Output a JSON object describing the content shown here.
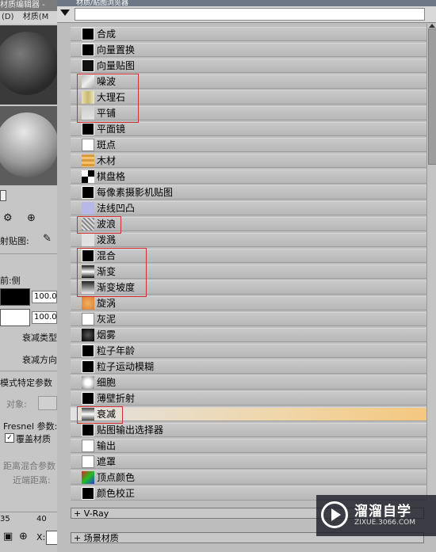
{
  "left_panel": {
    "title": "材质编辑器 -",
    "menu": [
      "(D)",
      "材质(M"
    ],
    "map_label": "射贴图:",
    "falloff_header": "前:侧",
    "val1": "100.0",
    "val2": "100.0",
    "falloff_type": "衰减类型",
    "falloff_dir": "衰减方向",
    "mode_params": "模式特定参数",
    "object_label": "对象:",
    "fresnel_label": "Fresnel 参数:",
    "override_label": "覆盖材质",
    "distance_blend": "距离混合参数",
    "near_distance": "近端距离:",
    "ruler": [
      "35",
      "40"
    ],
    "x_label": "X:"
  },
  "browser": {
    "title": "材质/贴图浏览器",
    "items": [
      {
        "label": "合成",
        "icon": "black-swatch-icon"
      },
      {
        "label": "向量置换",
        "icon": "black-swatch-icon"
      },
      {
        "label": "向量贴图",
        "icon": "vector-map-icon"
      },
      {
        "label": "噪波",
        "icon": "noise-icon"
      },
      {
        "label": "大理石",
        "icon": "marble-icon"
      },
      {
        "label": "平铺",
        "icon": "tiles-icon"
      },
      {
        "label": "平面镜",
        "icon": "black-swatch-icon"
      },
      {
        "label": "斑点",
        "icon": "white-swatch-icon"
      },
      {
        "label": "木材",
        "icon": "wood-icon"
      },
      {
        "label": "棋盘格",
        "icon": "checker-icon"
      },
      {
        "label": "每像素摄影机贴图",
        "icon": "black-swatch-icon"
      },
      {
        "label": "法线凹凸",
        "icon": "normal-bump-icon"
      },
      {
        "label": "波浪",
        "icon": "waves-icon"
      },
      {
        "label": "泼溅",
        "icon": "splat-icon"
      },
      {
        "label": "混合",
        "icon": "black-swatch-icon"
      },
      {
        "label": "渐变",
        "icon": "gradient-icon"
      },
      {
        "label": "渐变坡度",
        "icon": "gradient-ramp-icon"
      },
      {
        "label": "旋涡",
        "icon": "swirl-icon"
      },
      {
        "label": "灰泥",
        "icon": "white-swatch-icon"
      },
      {
        "label": "烟雾",
        "icon": "smoke-icon"
      },
      {
        "label": "粒子年龄",
        "icon": "black-swatch-icon"
      },
      {
        "label": "粒子运动模糊",
        "icon": "black-swatch-icon"
      },
      {
        "label": "细胞",
        "icon": "cellular-icon"
      },
      {
        "label": "薄壁折射",
        "icon": "black-swatch-icon"
      },
      {
        "label": "衰减",
        "icon": "falloff-icon"
      },
      {
        "label": "贴图输出选择器",
        "icon": "black-swatch-icon"
      },
      {
        "label": "输出",
        "icon": "white-swatch-icon"
      },
      {
        "label": "遮罩",
        "icon": "white-swatch-icon"
      },
      {
        "label": "顶点颜色",
        "icon": "vertex-color-icon"
      },
      {
        "label": "颜色校正",
        "icon": "black-swatch-icon"
      }
    ],
    "highlighted_index": 24,
    "rollouts": [
      "+ V-Ray",
      "+ 场景材质"
    ]
  },
  "watermark": {
    "line1": "溜溜自学",
    "line2": "ZIXUE.3066.COM"
  },
  "colors": {
    "highlight": "#f4c77e",
    "annotation_box": "#d23030"
  }
}
